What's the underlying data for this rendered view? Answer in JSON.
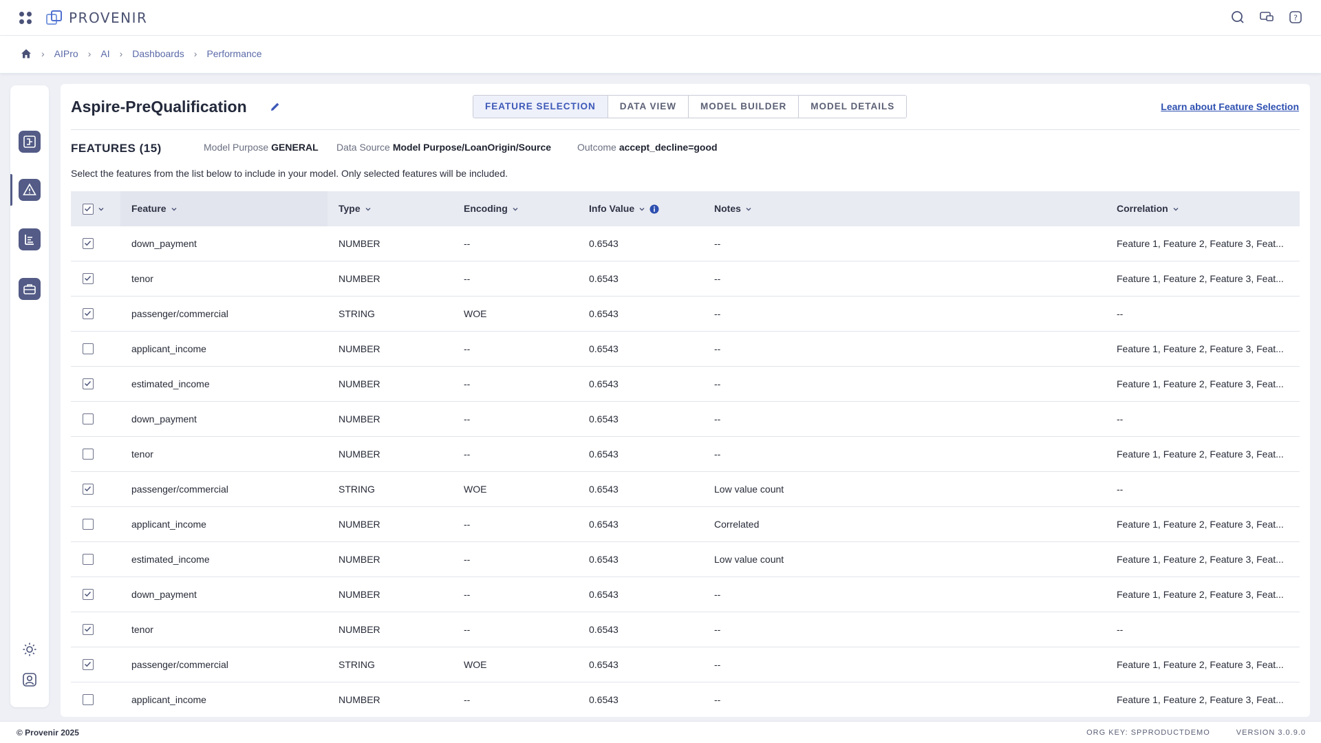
{
  "brand": {
    "name": "PROVENIR"
  },
  "breadcrumb": [
    "AIPro",
    "AI",
    "Dashboards",
    "Performance"
  ],
  "model": {
    "title": "Aspire-PreQualification"
  },
  "tabs": [
    {
      "label": "FEATURE SELECTION",
      "active": true
    },
    {
      "label": "DATA VIEW",
      "active": false
    },
    {
      "label": "MODEL BUILDER",
      "active": false
    },
    {
      "label": "MODEL DETAILS",
      "active": false
    }
  ],
  "learn_link": "Learn about Feature Selection",
  "features": {
    "heading": "FEATURES (15)",
    "model_purpose_label": "Model Purpose",
    "model_purpose_value": "GENERAL",
    "data_source_label": "Data Source",
    "data_source_value": "Model Purpose/LoanOrigin/Source",
    "outcome_label": "Outcome",
    "outcome_value": "accept_decline=good",
    "instructions": "Select the features from the list below to include in your model. Only selected features will be included."
  },
  "table": {
    "headers": {
      "feature": "Feature",
      "type": "Type",
      "encoding": "Encoding",
      "info_value": "Info Value",
      "notes": "Notes",
      "correlation": "Correlation"
    },
    "rows": [
      {
        "checked": true,
        "feature": "down_payment",
        "type": "NUMBER",
        "encoding": "--",
        "info_value": "0.6543",
        "notes": "--",
        "correlation": "Feature 1, Feature 2, Feature 3, Feat..."
      },
      {
        "checked": true,
        "feature": "tenor",
        "type": "NUMBER",
        "encoding": "--",
        "info_value": "0.6543",
        "notes": "--",
        "correlation": "Feature 1, Feature 2, Feature 3, Feat..."
      },
      {
        "checked": true,
        "feature": "passenger/commercial",
        "type": "STRING",
        "encoding": "WOE",
        "info_value": "0.6543",
        "notes": "--",
        "correlation": "--"
      },
      {
        "checked": false,
        "feature": "applicant_income",
        "type": "NUMBER",
        "encoding": "--",
        "info_value": "0.6543",
        "notes": "--",
        "correlation": "Feature 1, Feature 2, Feature 3, Feat..."
      },
      {
        "checked": true,
        "feature": "estimated_income",
        "type": "NUMBER",
        "encoding": "--",
        "info_value": "0.6543",
        "notes": "--",
        "correlation": "Feature 1, Feature 2, Feature 3, Feat..."
      },
      {
        "checked": false,
        "feature": "down_payment",
        "type": "NUMBER",
        "encoding": "--",
        "info_value": "0.6543",
        "notes": "--",
        "correlation": "--"
      },
      {
        "checked": false,
        "feature": "tenor",
        "type": "NUMBER",
        "encoding": "--",
        "info_value": "0.6543",
        "notes": "--",
        "correlation": "Feature 1, Feature 2, Feature 3, Feat..."
      },
      {
        "checked": true,
        "feature": "passenger/commercial",
        "type": "STRING",
        "encoding": "WOE",
        "info_value": "0.6543",
        "notes": "Low value count",
        "correlation": "--"
      },
      {
        "checked": false,
        "feature": "applicant_income",
        "type": "NUMBER",
        "encoding": "--",
        "info_value": "0.6543",
        "notes": "Correlated",
        "correlation": "Feature 1, Feature 2, Feature 3, Feat..."
      },
      {
        "checked": false,
        "feature": "estimated_income",
        "type": "NUMBER",
        "encoding": "--",
        "info_value": "0.6543",
        "notes": "Low value count",
        "correlation": "Feature 1, Feature 2, Feature 3, Feat..."
      },
      {
        "checked": true,
        "feature": "down_payment",
        "type": "NUMBER",
        "encoding": "--",
        "info_value": "0.6543",
        "notes": "--",
        "correlation": "Feature 1, Feature 2, Feature 3, Feat..."
      },
      {
        "checked": true,
        "feature": "tenor",
        "type": "NUMBER",
        "encoding": "--",
        "info_value": "0.6543",
        "notes": "--",
        "correlation": "--"
      },
      {
        "checked": true,
        "feature": "passenger/commercial",
        "type": "STRING",
        "encoding": "WOE",
        "info_value": "0.6543",
        "notes": "--",
        "correlation": "Feature 1, Feature 2, Feature 3, Feat..."
      },
      {
        "checked": false,
        "feature": "applicant_income",
        "type": "NUMBER",
        "encoding": "--",
        "info_value": "0.6543",
        "notes": "--",
        "correlation": "Feature 1, Feature 2, Feature 3, Feat..."
      }
    ]
  },
  "footer": {
    "copyright": "© Provenir 2025",
    "org_key": "ORG KEY: SPPRODUCTDEMO",
    "version": "VERSION 3.0.9.0"
  },
  "colors": {
    "accent": "#535b86",
    "link": "#2d4fb0",
    "active_tab": "#3d58b8"
  }
}
